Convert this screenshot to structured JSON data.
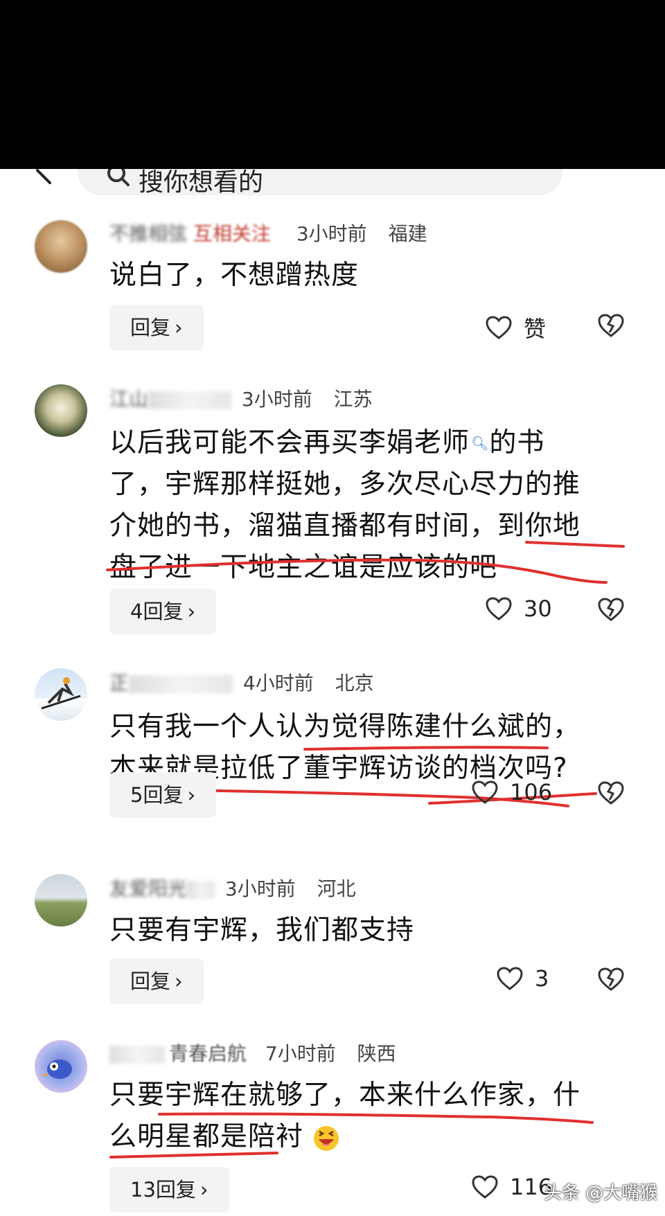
{
  "search": {
    "text": "搜你想看的"
  },
  "comments": [
    {
      "name": "不推相弦",
      "follow": "互相关注",
      "time": "3小时前",
      "location": "福建",
      "text": "说白了，不想蹭热度",
      "reply_label": "回复",
      "likes": "赞"
    },
    {
      "name": "江山",
      "time": "3小时前",
      "location": "江苏",
      "text_lines": [
        "以后我可能不会再买李娟老师",
        "的书",
        "了，宇辉那样挺她，多次尽心尽力的推",
        "介她的书，溜猫直播都有时间，到你地",
        "盘了进一下地主之谊是应该的吧"
      ],
      "reply_label": "4回复",
      "likes": "30"
    },
    {
      "name": "正",
      "time": "4小时前",
      "location": "北京",
      "text_lines": [
        "只有我一个人认为觉得陈建什么斌的，",
        "本来就是拉低了董宇辉访谈的档次吗?"
      ],
      "reply_label": "5回复",
      "likes": "106"
    },
    {
      "name": "友爱阳光",
      "time": "3小时前",
      "location": "河北",
      "text": "只要有宇辉，我们都支持",
      "reply_label": "回复",
      "likes": "3"
    },
    {
      "name": "青春启航",
      "time": "7小时前",
      "location": "陕西",
      "text_lines": [
        "只要宇辉在就够了，本来什么作家，什",
        "么明星都是陪衬"
      ],
      "reply_label": "13回复",
      "likes": "116"
    }
  ],
  "watermark": "头条 @大嘴猴",
  "colors": {
    "underline": "#e03030",
    "background": "#ffffff",
    "reply_bg": "#f3f3f5"
  }
}
